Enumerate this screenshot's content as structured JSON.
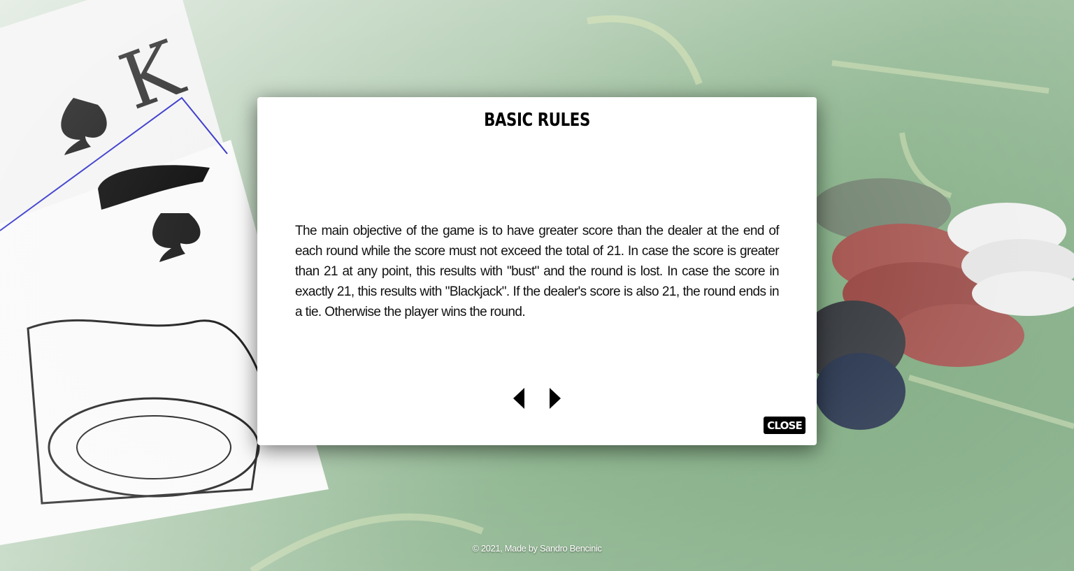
{
  "modal": {
    "title": "BASIC RULES",
    "text": "The main objective of the game is to have greater score than the dealer at the end of each round while the score must not exceed the total of 21. In case the score is greater than 21 at any point, this results with \"bust\" and the round is lost. In case the score in exactly 21, this results with \"Blackjack\". If the dealer's score is also 21, the round ends in a tie. Otherwise the player wins the round.",
    "close_label": "CLOSE",
    "prev_icon": "caret-left-icon",
    "next_icon": "caret-right-icon"
  },
  "footer": {
    "text": "© 2021, Made by Sandro Bencinic"
  },
  "colors": {
    "felt": "#6f9f72",
    "modal_bg": "#ffffff",
    "button_bg": "#000000"
  }
}
